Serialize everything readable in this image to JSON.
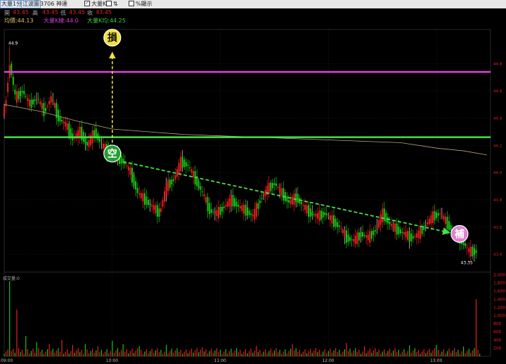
{
  "toolbar": {
    "period": "大量1分K",
    "exchange": "江波圖",
    "symbol": "3706 神達",
    "big_k_label": "大量K",
    "arrows_label": "⇅",
    "percent_label": "%顯示"
  },
  "quote": {
    "open_label": "開",
    "open_value": "43.45",
    "high_label": "高",
    "high_value": "43.45",
    "low_label": "低",
    "low_value": "43.45",
    "close_label": "收",
    "close_value": "43.45",
    "vwap_text": "均價:44.13",
    "bigk_text": "大量K線:44.0",
    "bigk_avg_text": "大量K均:44.25"
  },
  "volume_panel": {
    "title": "成交量:0"
  },
  "colors": {
    "up": "#e62020",
    "down": "#17c617",
    "vwap": "#b8a878",
    "stop_line": "#e040e0",
    "support_line": "#48e048",
    "stop_badge": "#f0e040",
    "short_badge": "#20a030",
    "cover_badge": "#e080d0"
  },
  "chart_data": {
    "type": "candlestick",
    "price_axis": {
      "min": 43.3,
      "max": 45.0,
      "ticks": [
        "44.8",
        "44.6",
        "44.4",
        "44.2",
        "44.0",
        "43.8",
        "43.6",
        "43.4"
      ]
    },
    "volume_axis": {
      "min": 0,
      "max": 2000,
      "ticks": [
        "2,000",
        "1,800",
        "1,600",
        "1,400",
        "1,200",
        "1,000",
        "800",
        "600",
        "400",
        "200"
      ]
    },
    "time_labels": [
      {
        "label": "09:00",
        "minute": 0
      },
      {
        "label": "10:00",
        "minute": 60
      },
      {
        "label": "11:00",
        "minute": 120
      },
      {
        "label": "12:00",
        "minute": 180
      },
      {
        "label": "13:00",
        "minute": 240
      }
    ],
    "session_minutes": 270,
    "high_label": "44.9",
    "low_label": "43.35",
    "stop_line_price": 44.74,
    "support_line_price": 44.26,
    "badges": [
      {
        "text": "損",
        "minute": 60,
        "price": 44.95
      },
      {
        "text": "空",
        "minute": 60,
        "price": 44.14
      },
      {
        "text": "補",
        "minute": 252,
        "price": 43.55
      }
    ],
    "arrows": [
      {
        "from_minute": 60,
        "from_price": 44.22,
        "to_minute": 60,
        "to_price": 44.88
      },
      {
        "from_minute": 66,
        "from_price": 44.08,
        "to_minute": 247,
        "to_price": 43.56
      }
    ],
    "vwap_path": [
      [
        0,
        44.5
      ],
      [
        20,
        44.45
      ],
      [
        40,
        44.38
      ],
      [
        60,
        44.32
      ],
      [
        80,
        44.3
      ],
      [
        100,
        44.28
      ],
      [
        120,
        44.27
      ],
      [
        140,
        44.26
      ],
      [
        160,
        44.25
      ],
      [
        180,
        44.24
      ],
      [
        200,
        44.23
      ],
      [
        220,
        44.22
      ],
      [
        240,
        44.18
      ],
      [
        255,
        44.16
      ],
      [
        268,
        44.13
      ]
    ],
    "price_path": [
      [
        0,
        44.45
      ],
      [
        3,
        44.8
      ],
      [
        6,
        44.55
      ],
      [
        10,
        44.6
      ],
      [
        14,
        44.5
      ],
      [
        18,
        44.55
      ],
      [
        22,
        44.45
      ],
      [
        26,
        44.55
      ],
      [
        30,
        44.4
      ],
      [
        34,
        44.35
      ],
      [
        38,
        44.25
      ],
      [
        42,
        44.3
      ],
      [
        46,
        44.2
      ],
      [
        50,
        44.3
      ],
      [
        54,
        44.2
      ],
      [
        58,
        44.15
      ],
      [
        62,
        44.12
      ],
      [
        66,
        44.08
      ],
      [
        70,
        44.0
      ],
      [
        74,
        43.85
      ],
      [
        78,
        43.8
      ],
      [
        82,
        43.75
      ],
      [
        86,
        43.7
      ],
      [
        90,
        43.9
      ],
      [
        94,
        43.95
      ],
      [
        98,
        44.08
      ],
      [
        102,
        44.05
      ],
      [
        106,
        43.95
      ],
      [
        110,
        43.85
      ],
      [
        114,
        43.72
      ],
      [
        118,
        43.7
      ],
      [
        122,
        43.75
      ],
      [
        126,
        43.8
      ],
      [
        130,
        43.75
      ],
      [
        134,
        43.72
      ],
      [
        138,
        43.68
      ],
      [
        142,
        43.8
      ],
      [
        146,
        43.88
      ],
      [
        150,
        43.92
      ],
      [
        154,
        43.85
      ],
      [
        158,
        43.78
      ],
      [
        162,
        43.82
      ],
      [
        166,
        43.75
      ],
      [
        170,
        43.7
      ],
      [
        174,
        43.68
      ],
      [
        178,
        43.7
      ],
      [
        182,
        43.65
      ],
      [
        186,
        43.6
      ],
      [
        190,
        43.52
      ],
      [
        194,
        43.5
      ],
      [
        198,
        43.55
      ],
      [
        202,
        43.52
      ],
      [
        206,
        43.58
      ],
      [
        210,
        43.7
      ],
      [
        214,
        43.62
      ],
      [
        218,
        43.58
      ],
      [
        222,
        43.55
      ],
      [
        226,
        43.52
      ],
      [
        230,
        43.55
      ],
      [
        234,
        43.62
      ],
      [
        238,
        43.68
      ],
      [
        242,
        43.7
      ],
      [
        246,
        43.62
      ],
      [
        250,
        43.55
      ],
      [
        254,
        43.5
      ],
      [
        258,
        43.42
      ],
      [
        262,
        43.42
      ]
    ],
    "volume_spikes": [
      [
        3,
        1850
      ],
      [
        7,
        1150
      ],
      [
        12,
        500
      ],
      [
        18,
        350
      ],
      [
        25,
        300
      ],
      [
        32,
        400
      ],
      [
        38,
        280
      ],
      [
        45,
        300
      ],
      [
        52,
        250
      ],
      [
        60,
        380
      ],
      [
        66,
        300
      ],
      [
        75,
        250
      ],
      [
        90,
        280
      ],
      [
        110,
        220
      ],
      [
        140,
        260
      ],
      [
        160,
        300
      ],
      [
        190,
        330
      ],
      [
        200,
        250
      ],
      [
        225,
        270
      ],
      [
        240,
        280
      ],
      [
        255,
        240
      ],
      [
        262,
        1400
      ]
    ]
  }
}
